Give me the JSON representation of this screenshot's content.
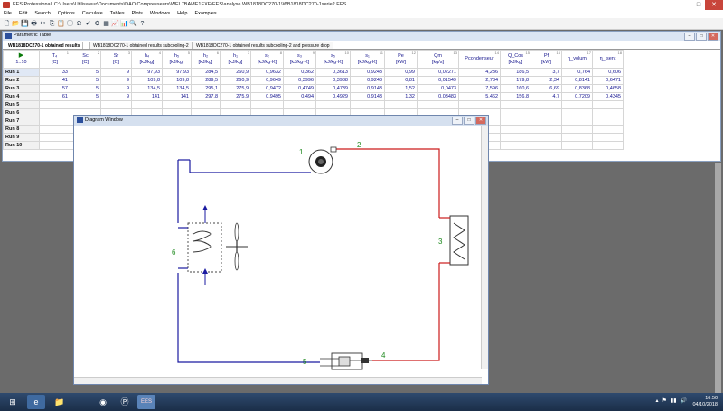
{
  "app": {
    "title": "EES Professional: C:\\Users\\Utilisateur\\Documents\\DAO Compresseurs\\WEL7BAME1EXE\\EES\\analyse WB1818DC270-1\\WB1818DC270-1serie2.EES",
    "controls": {
      "minimize": "–",
      "maximize": "□",
      "close": "✕"
    }
  },
  "menu": [
    "File",
    "Edit",
    "Search",
    "Options",
    "Calculate",
    "Tables",
    "Plots",
    "Windows",
    "Help",
    "Examples"
  ],
  "toolbar_icons": [
    "new-file-icon",
    "open-folder-icon",
    "save-icon",
    "print-icon",
    "cut-icon",
    "copy-icon",
    "paste-icon",
    "info-icon",
    "units-icon",
    "check-icon",
    "solve-icon",
    "table-icon",
    "plot-icon",
    "graph-icon",
    "lookup-icon",
    "help-icon"
  ],
  "toolbar_glyphs": [
    "🗋",
    "📂",
    "💾",
    "🖶",
    "✂",
    "⎘",
    "📋",
    "ⓘ",
    "Ω",
    "✔",
    "⚙",
    "▦",
    "📈",
    "📊",
    "🔍",
    "?"
  ],
  "param_window": {
    "title": "Parametric Table",
    "tabs": [
      "WB1818DC270-1 obtained results",
      "WB1818DC270-1 obtained results subcooling-2",
      "WB1818DC270-1 obtained results subcooling-2 and pressure drop"
    ],
    "run_control": "▶",
    "run_range": "1..10",
    "columns": [
      {
        "name": "T₄",
        "unit": "[C]",
        "num": "1"
      },
      {
        "name": "Sc",
        "unit": "[C]",
        "num": "2"
      },
      {
        "name": "Sr",
        "unit": "[C]",
        "num": "3"
      },
      {
        "name": "h₄",
        "unit": "[kJ/kg]",
        "num": "4"
      },
      {
        "name": "h₅",
        "unit": "[kJ/kg]",
        "num": "5"
      },
      {
        "name": "h₂",
        "unit": "[kJ/kg]",
        "num": "6"
      },
      {
        "name": "h₁",
        "unit": "[kJ/kg]",
        "num": "7"
      },
      {
        "name": "s₂",
        "unit": "[kJ/kg·K]",
        "num": "8"
      },
      {
        "name": "s₃",
        "unit": "[kJ/kg·K]",
        "num": "9"
      },
      {
        "name": "s₅",
        "unit": "[kJ/kg·K]",
        "num": "10"
      },
      {
        "name": "s₁",
        "unit": "[kJ/kg·K]",
        "num": "11"
      },
      {
        "name": "Pe",
        "unit": "[kW]",
        "num": "12"
      },
      {
        "name": "Qm",
        "unit": "[kg/s]",
        "num": "13"
      },
      {
        "name": "Pcondenseur",
        "unit": "",
        "num": "14"
      },
      {
        "name": "Q_Cos",
        "unit": "[kJ/kg]",
        "num": "15"
      },
      {
        "name": "Pf",
        "unit": "[kW]",
        "num": "16"
      },
      {
        "name": "η_volum",
        "unit": "",
        "num": "17"
      },
      {
        "name": "η_isent",
        "unit": "",
        "num": "18"
      }
    ],
    "rows": [
      {
        "label": "Run 1",
        "values": [
          "33",
          "5",
          "9",
          "97,93",
          "97,93",
          "284,5",
          "260,9",
          "0,9632",
          "0,362",
          "0,3613",
          "0,9243",
          "0,99",
          "0,02271",
          "4,236",
          "186,5",
          "3,7",
          "0,764",
          "0,606"
        ]
      },
      {
        "label": "Run 2",
        "values": [
          "41",
          "5",
          "9",
          "109,8",
          "109,8",
          "289,5",
          "260,9",
          "0,9649",
          "0,3996",
          "0,3988",
          "0,9243",
          "0,81",
          "0,01549",
          "2,784",
          "179,8",
          "2,34",
          "0,8141",
          "0,6471"
        ]
      },
      {
        "label": "Run 3",
        "values": [
          "57",
          "5",
          "9",
          "134,5",
          "134,5",
          "295,1",
          "275,9",
          "0,9472",
          "0,4749",
          "0,4739",
          "0,9143",
          "1,52",
          "0,0473",
          "7,596",
          "160,6",
          "6,69",
          "0,8368",
          "0,4658"
        ]
      },
      {
        "label": "Run 4",
        "values": [
          "61",
          "5",
          "9",
          "141",
          "141",
          "297,8",
          "275,9",
          "0,9495",
          "0,494",
          "0,4929",
          "0,9143",
          "1,32",
          "0,03483",
          "5,462",
          "156,8",
          "4,7",
          "0,7209",
          "0,4345"
        ]
      },
      {
        "label": "Run 5",
        "values": []
      },
      {
        "label": "Run 6",
        "values": []
      },
      {
        "label": "Run 7",
        "values": []
      },
      {
        "label": "Run 8",
        "values": []
      },
      {
        "label": "Run 9",
        "values": []
      },
      {
        "label": "Run 10",
        "values": []
      }
    ]
  },
  "diagram_window": {
    "title": "Diagram Window",
    "labels": {
      "n1": "1",
      "n2": "2",
      "n3": "3",
      "n4": "4",
      "n5": "5",
      "n6": "6"
    },
    "colors": {
      "cold": "#1a1aa0",
      "hot": "#cc1a1a",
      "label": "#1f8a1f"
    }
  },
  "taskbar": {
    "apps": [
      "start-orb-icon",
      "internet-explorer-icon",
      "file-explorer-icon",
      "chrome-icon",
      "eclipse-icon",
      "ees-icon"
    ],
    "glyphs": [
      "⊞",
      "e",
      "📁",
      "◉",
      "Ⓟ",
      "EES"
    ],
    "tray": [
      "▴",
      "⚑",
      "▮▮",
      "🔊"
    ],
    "time": "16:50",
    "date": "04/10/2018"
  }
}
